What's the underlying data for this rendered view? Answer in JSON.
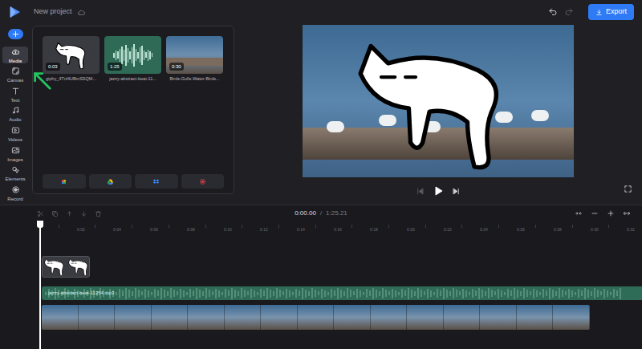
{
  "project": {
    "title": "New project"
  },
  "toolbar": {
    "export": "Export"
  },
  "sidebar": {
    "items": [
      {
        "label": "Media",
        "selected": true
      },
      {
        "label": "Canvas",
        "selected": false
      },
      {
        "label": "Text",
        "selected": false
      },
      {
        "label": "Audio",
        "selected": false
      },
      {
        "label": "Videos",
        "selected": false
      },
      {
        "label": "Images",
        "selected": false
      },
      {
        "label": "Elements",
        "selected": false
      },
      {
        "label": "Record",
        "selected": false
      }
    ]
  },
  "media": [
    {
      "name": "giphy_4Tnl4UBmSSQM...",
      "duration": "0:03",
      "kind": "sticker"
    },
    {
      "name": "jazzy-abstract-beat-11...",
      "duration": "1:25",
      "kind": "audio"
    },
    {
      "name": "Birds-Gulls-Water-Birds...",
      "duration": "0:30",
      "kind": "video"
    }
  ],
  "timeline": {
    "current": "0:00.00",
    "separator": "/",
    "total": "1:25.21",
    "ruler": [
      "0:02",
      "0:04",
      "0:06",
      "0:08",
      "0:10",
      "0:12",
      "0:14",
      "0:16",
      "0:18",
      "0:20",
      "0:22",
      "0:24",
      "0:26",
      "0:28",
      "0:30",
      "0:32"
    ],
    "tracks": [
      {
        "kind": "sticker"
      },
      {
        "kind": "audio",
        "label": "jazzy-abstract-beat-11254.mp3"
      },
      {
        "kind": "video"
      }
    ]
  }
}
